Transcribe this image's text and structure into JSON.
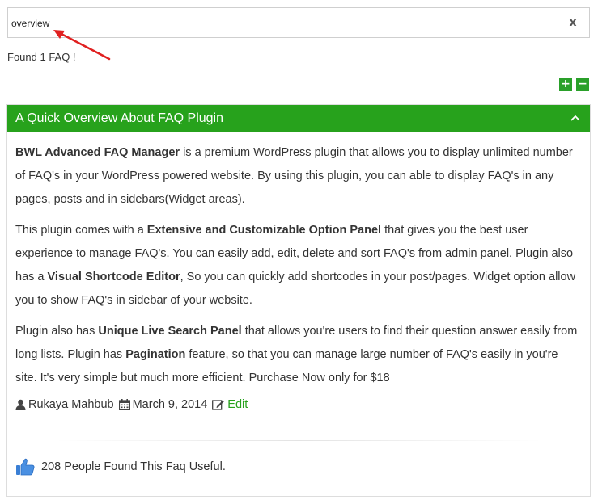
{
  "search": {
    "value": "overview",
    "clear_label": "x"
  },
  "results": {
    "found_text": "Found 1 FAQ !"
  },
  "controls": {
    "expand_all_label": "+",
    "collapse_all_label": "−"
  },
  "faq": {
    "title": "A Quick Overview About FAQ Plugin",
    "p1_bold": "BWL Advanced FAQ Manager",
    "p1_text": " is a premium WordPress plugin that allows you to display unlimited number of FAQ's in your WordPress powered website. By using this plugin, you can able to display FAQ's in any pages, posts and in sidebars(Widget areas).",
    "p2_a": "This plugin comes with a ",
    "p2_bold1": "Extensive and Customizable Option Panel",
    "p2_b": " that gives you the best user experience to manage FAQ's. You can easily add, edit, delete and sort FAQ's from admin panel. Plugin also has a ",
    "p2_bold2": "Visual Shortcode Editor",
    "p2_c": ", So you can quickly add shortcodes in your post/pages. Widget option allow you to show FAQ's in sidebar of your website.",
    "p3_a": "Plugin also has ",
    "p3_bold1": "Unique Live Search Panel",
    "p3_b": " that allows you're users to find their question answer easily from long lists. Plugin has ",
    "p3_bold2": "Pagination",
    "p3_c": " feature, so that you can manage large number of FAQ's easily in you're site. It's very simple but much more efficient. Purchase Now only for $18",
    "author": "Rukaya Mahbub",
    "date": "March 9, 2014",
    "edit_label": "Edit",
    "useful_text": "208 People Found This Faq Useful."
  },
  "colors": {
    "accent_green": "#27a21c",
    "annotation_red": "#e02020"
  },
  "icons": [
    "close-icon",
    "plus-icon",
    "minus-icon",
    "chevron-up-icon",
    "user-icon",
    "calendar-icon",
    "edit-icon",
    "thumbs-up-icon"
  ]
}
